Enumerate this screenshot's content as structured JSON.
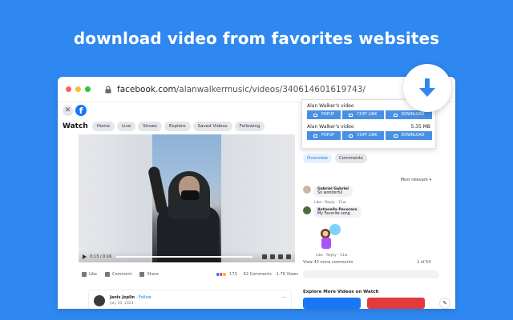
{
  "headline": "download video from favorites websites",
  "browser": {
    "url_host": "facebook.com",
    "url_path": "/alanwalkermusic/videos/340614601619743/"
  },
  "facebook": {
    "logo": "f",
    "watch_title": "Watch",
    "nav": [
      "Home",
      "Live",
      "Shows",
      "Explore",
      "Saved Videos",
      "Following"
    ],
    "video_time": "0:13 / 0:16",
    "actions": {
      "like": "Like",
      "comment": "Comment",
      "share": "Share"
    },
    "reaction_count": "173",
    "comments_count": "62 Comments",
    "views": "1.7K Views",
    "post": {
      "name": "Janis Joplin",
      "follow": "· Follow",
      "date": "July 10, 2021 ·",
      "more": "..."
    }
  },
  "sidebar": {
    "tabs": [
      "Overview",
      "Comments"
    ],
    "relevance": "Most relevant ▾",
    "comments": [
      {
        "name": "Gabriel Gabriel",
        "text": "So wonderful",
        "meta": "Like · Reply · 11w"
      },
      {
        "name": "Antonella Pecoraro",
        "text": "My Favorite song",
        "meta": "Like · Reply · 11w"
      }
    ],
    "sticker_meta": "Like · Reply · 11w",
    "view_more": "View 43 more comments",
    "page_count": "2 of 54",
    "explore_title": "Explore More Videos on Watch"
  },
  "popup": {
    "items": [
      {
        "title": "Alan Walker's video",
        "size": ""
      },
      {
        "title": "Alan Walker's video",
        "size": "5.35 MB"
      }
    ],
    "buttons": {
      "popup": "POPUP",
      "copy": "COPY LINK",
      "download": "DOWNLOAD"
    }
  },
  "icons": {
    "download": "download-arrow-icon",
    "lock": "lock-icon",
    "close": "close-icon"
  },
  "colors": {
    "background": "#2f88f0",
    "facebook_blue": "#1877f2",
    "button_blue": "#4a90e2",
    "download_arrow": "#2f88f0"
  }
}
